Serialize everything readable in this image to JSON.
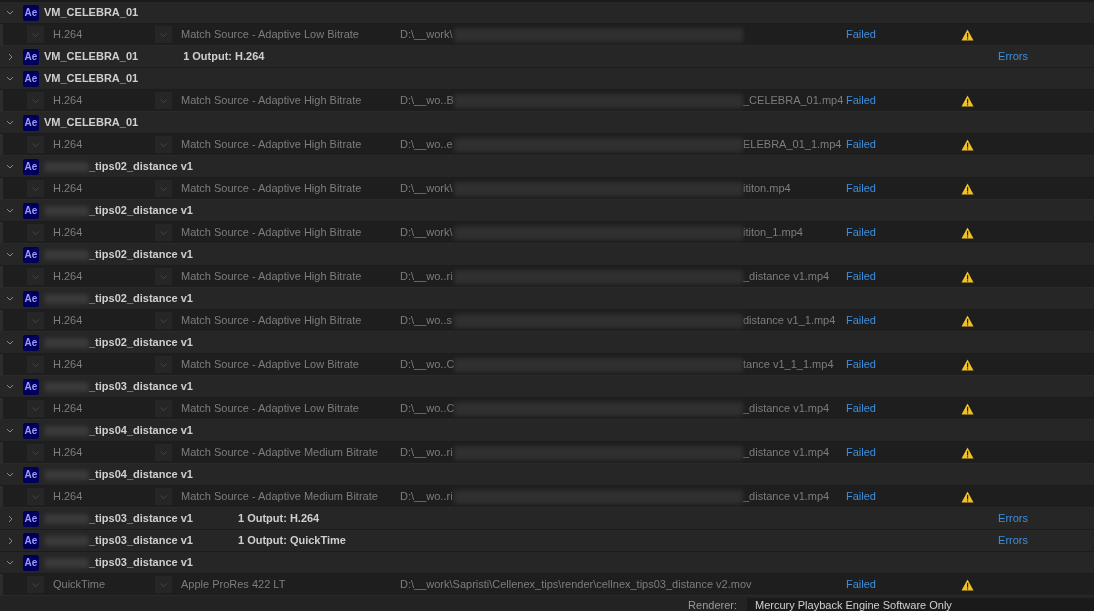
{
  "queue": [
    {
      "kind": "source",
      "expanded": true,
      "badge": "Ae",
      "redacted": false,
      "name": "VM_CELEBRA_01"
    },
    {
      "kind": "output",
      "format": "H.264",
      "preset": "Match Source - Adaptive Low Bitrate",
      "path_prefix": "D:\\__work\\",
      "redacted": true,
      "status": "Failed"
    },
    {
      "kind": "source",
      "expanded": false,
      "badge": "Ae",
      "redacted": false,
      "name": "VM_CELEBRA_01",
      "summary": "1 Output: H.264",
      "status": "Errors"
    },
    {
      "kind": "source",
      "expanded": true,
      "badge": "Ae",
      "redacted": false,
      "name": "VM_CELEBRA_01"
    },
    {
      "kind": "output",
      "format": "H.264",
      "preset": "Match Source - Adaptive High Bitrate",
      "path_prefix": "D:\\__wo..B",
      "redacted": true,
      "path_suffix": "_CELEBRA_01.mp4",
      "status": "Failed"
    },
    {
      "kind": "source",
      "expanded": true,
      "badge": "Ae",
      "redacted": false,
      "name": "VM_CELEBRA_01"
    },
    {
      "kind": "output",
      "format": "H.264",
      "preset": "Match Source - Adaptive High Bitrate",
      "path_prefix": "D:\\__wo..e",
      "redacted": true,
      "path_suffix": "ELEBRA_01_1.mp4",
      "status": "Failed"
    },
    {
      "kind": "source",
      "expanded": true,
      "badge": "Ae",
      "redacted": true,
      "name": "_tips02_distance v1"
    },
    {
      "kind": "output",
      "format": "H.264",
      "preset": "Match Source - Adaptive High Bitrate",
      "path_prefix": "D:\\__work\\",
      "redacted": true,
      "path_suffix": "ititon.mp4",
      "status": "Failed"
    },
    {
      "kind": "source",
      "expanded": true,
      "badge": "Ae",
      "redacted": true,
      "name": "_tips02_distance v1"
    },
    {
      "kind": "output",
      "format": "H.264",
      "preset": "Match Source - Adaptive High Bitrate",
      "path_prefix": "D:\\__work\\",
      "redacted": true,
      "path_suffix": "ititon_1.mp4",
      "status": "Failed"
    },
    {
      "kind": "source",
      "expanded": true,
      "badge": "Ae",
      "redacted": true,
      "name": "_tips02_distance v1"
    },
    {
      "kind": "output",
      "format": "H.264",
      "preset": "Match Source - Adaptive High Bitrate",
      "path_prefix": "D:\\__wo..ri",
      "redacted": true,
      "path_suffix": "_distance v1.mp4",
      "status": "Failed"
    },
    {
      "kind": "source",
      "expanded": true,
      "badge": "Ae",
      "redacted": true,
      "name": "_tips02_distance v1"
    },
    {
      "kind": "output",
      "format": "H.264",
      "preset": "Match Source - Adaptive High Bitrate",
      "path_prefix": "D:\\__wo..s",
      "redacted": true,
      "path_suffix": "distance v1_1.mp4",
      "status": "Failed"
    },
    {
      "kind": "source",
      "expanded": true,
      "badge": "Ae",
      "redacted": true,
      "name": "_tips02_distance v1"
    },
    {
      "kind": "output",
      "format": "H.264",
      "preset": "Match Source - Adaptive Low Bitrate",
      "path_prefix": "D:\\__wo..C",
      "redacted": true,
      "path_suffix": "tance v1_1_1.mp4",
      "status": "Failed"
    },
    {
      "kind": "source",
      "expanded": true,
      "badge": "Ae",
      "redacted": true,
      "name": "_tips03_distance v1"
    },
    {
      "kind": "output",
      "format": "H.264",
      "preset": "Match Source - Adaptive Low Bitrate",
      "path_prefix": "D:\\__wo..C",
      "redacted": true,
      "path_suffix": "_distance v1.mp4",
      "status": "Failed"
    },
    {
      "kind": "source",
      "expanded": true,
      "badge": "Ae",
      "redacted": true,
      "name": "_tips04_distance v1"
    },
    {
      "kind": "output",
      "format": "H.264",
      "preset": "Match Source - Adaptive Medium Bitrate",
      "path_prefix": "D:\\__wo..ri",
      "redacted": true,
      "path_suffix": "_distance v1.mp4",
      "status": "Failed"
    },
    {
      "kind": "source",
      "expanded": true,
      "badge": "Ae",
      "redacted": true,
      "name": "_tips04_distance v1"
    },
    {
      "kind": "output",
      "format": "H.264",
      "preset": "Match Source - Adaptive Medium Bitrate",
      "path_prefix": "D:\\__wo..ri",
      "redacted": true,
      "path_suffix": "_distance v1.mp4",
      "status": "Failed"
    },
    {
      "kind": "source",
      "expanded": false,
      "badge": "Ae",
      "redacted": true,
      "name": "_tips03_distance v1",
      "summary": "1 Output: H.264",
      "status": "Errors"
    },
    {
      "kind": "source",
      "expanded": false,
      "badge": "Ae",
      "redacted": true,
      "name": "_tips03_distance v1",
      "summary": "1 Output: QuickTime",
      "status": "Errors"
    },
    {
      "kind": "source",
      "expanded": true,
      "badge": "Ae",
      "redacted": true,
      "name": "_tips03_distance v1"
    },
    {
      "kind": "output",
      "format": "QuickTime",
      "preset": "Apple ProRes 422 LT",
      "path_prefix": "D:\\__work\\Sapristi\\Cellenex_tips\\render\\cellnex_tips03_distance v2.mov",
      "redacted": false,
      "status": "Failed"
    }
  ],
  "renderer": {
    "label": "Renderer:",
    "value": "Mercury Playback Engine Software Only"
  }
}
